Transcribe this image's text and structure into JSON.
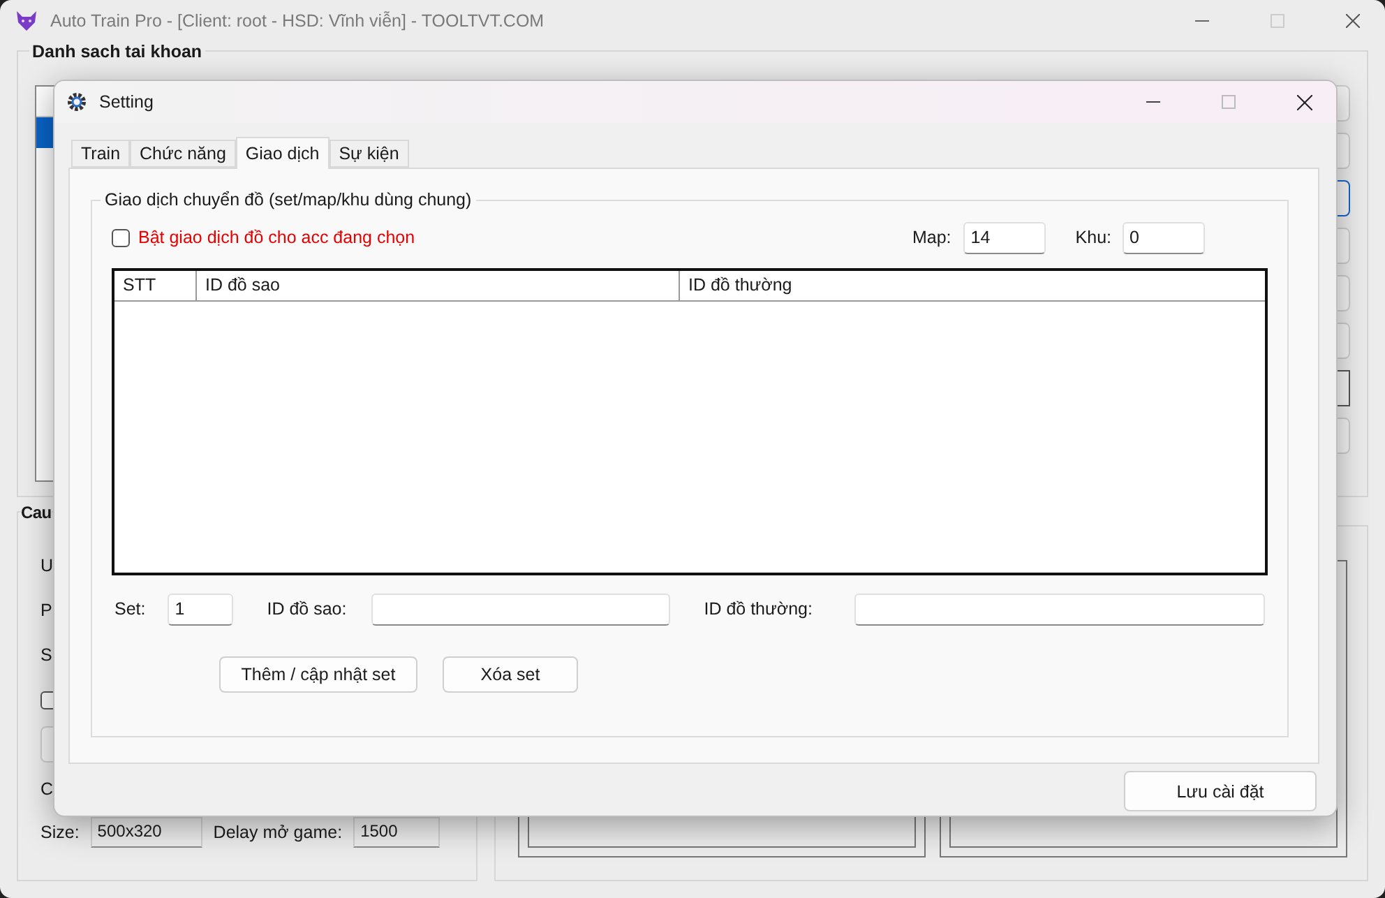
{
  "main_window": {
    "title": "Auto Train Pro - [Client: root - HSD: Vĩnh viễn] - TOOLTVT.COM",
    "accounts_group": {
      "title": "Danh sach tai khoan",
      "rows": [
        {
          "selected": true
        }
      ]
    },
    "config_group": {
      "title": "Cau",
      "labels": [
        "U",
        "P",
        "S",
        "C"
      ],
      "checkbox": {
        "checked": false
      },
      "size_label": "Size:",
      "size_value": "500x320",
      "delay_label": "Delay mở game:",
      "delay_value": "1500"
    }
  },
  "dialog": {
    "title": "Setting",
    "tabs": [
      {
        "label": "Train",
        "selected": false
      },
      {
        "label": "Chức năng",
        "selected": false
      },
      {
        "label": "Giao dịch",
        "selected": true
      },
      {
        "label": "Sự kiện",
        "selected": false
      }
    ],
    "group_title": "Giao dịch chuyển đồ (set/map/khu dùng chung)",
    "enable_checkbox": {
      "label": "Bật giao dịch đồ cho acc đang chọn",
      "checked": false
    },
    "map_label": "Map:",
    "map_value": "14",
    "khu_label": "Khu:",
    "khu_value": "0",
    "table": {
      "columns": [
        "STT",
        "ID đồ sao",
        "ID đồ thường"
      ]
    },
    "set_label": "Set:",
    "set_value": "1",
    "star_label": "ID đồ sao:",
    "normal_label": "ID đồ thường:",
    "buttons": [
      "Thêm / cập nhật set",
      "Xóa set"
    ],
    "save_button": "Lưu cài đặt"
  }
}
